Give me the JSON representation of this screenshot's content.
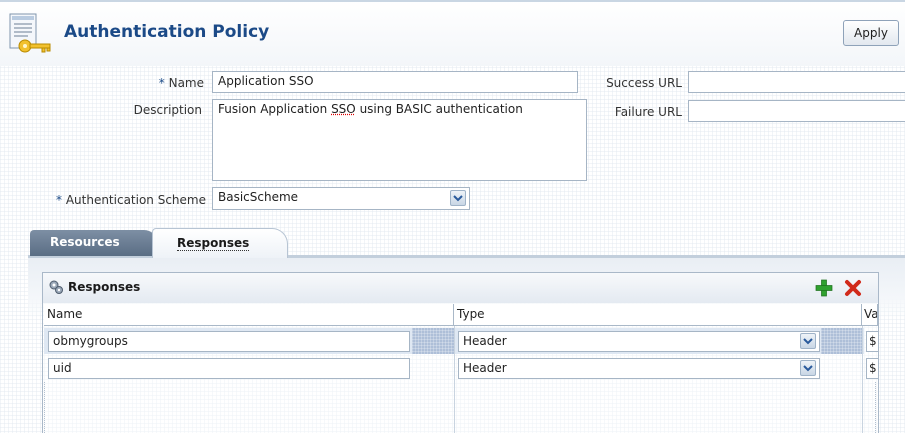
{
  "header": {
    "title": "Authentication Policy",
    "apply_label": "Apply"
  },
  "form": {
    "name": {
      "label": "Name",
      "required_mark": "*",
      "value": "Application SSO"
    },
    "description": {
      "label": "Description",
      "value_prefix": "Fusion Application ",
      "value_spell": "SSO",
      "value_suffix": " using BASIC authentication"
    },
    "auth_scheme": {
      "label": "Authentication Scheme",
      "required_mark": "*",
      "value": "BasicScheme"
    },
    "success_url": {
      "label": "Success URL",
      "value": ""
    },
    "failure_url": {
      "label": "Failure URL",
      "value": ""
    }
  },
  "tabs": [
    {
      "label": "Resources",
      "selected": false
    },
    {
      "label": "Responses",
      "selected": true
    }
  ],
  "responses_table": {
    "title": "Responses",
    "columns": [
      "Name",
      "Type",
      "Va"
    ],
    "rows": [
      {
        "name": "obmygroups",
        "type": "Header",
        "value": "$",
        "selected": true
      },
      {
        "name": "uid",
        "type": "Header",
        "value": "$",
        "selected": false
      }
    ]
  },
  "icons": {
    "page": "policy-key-icon",
    "columns": "gear-columns-icon",
    "add": "add-icon",
    "delete": "delete-icon",
    "dropdown": "chevron-down-icon"
  },
  "colors": {
    "title": "#1b4a87",
    "add": "#2fa12f",
    "delete": "#d12a1a",
    "selection": "#dfe8f3"
  }
}
